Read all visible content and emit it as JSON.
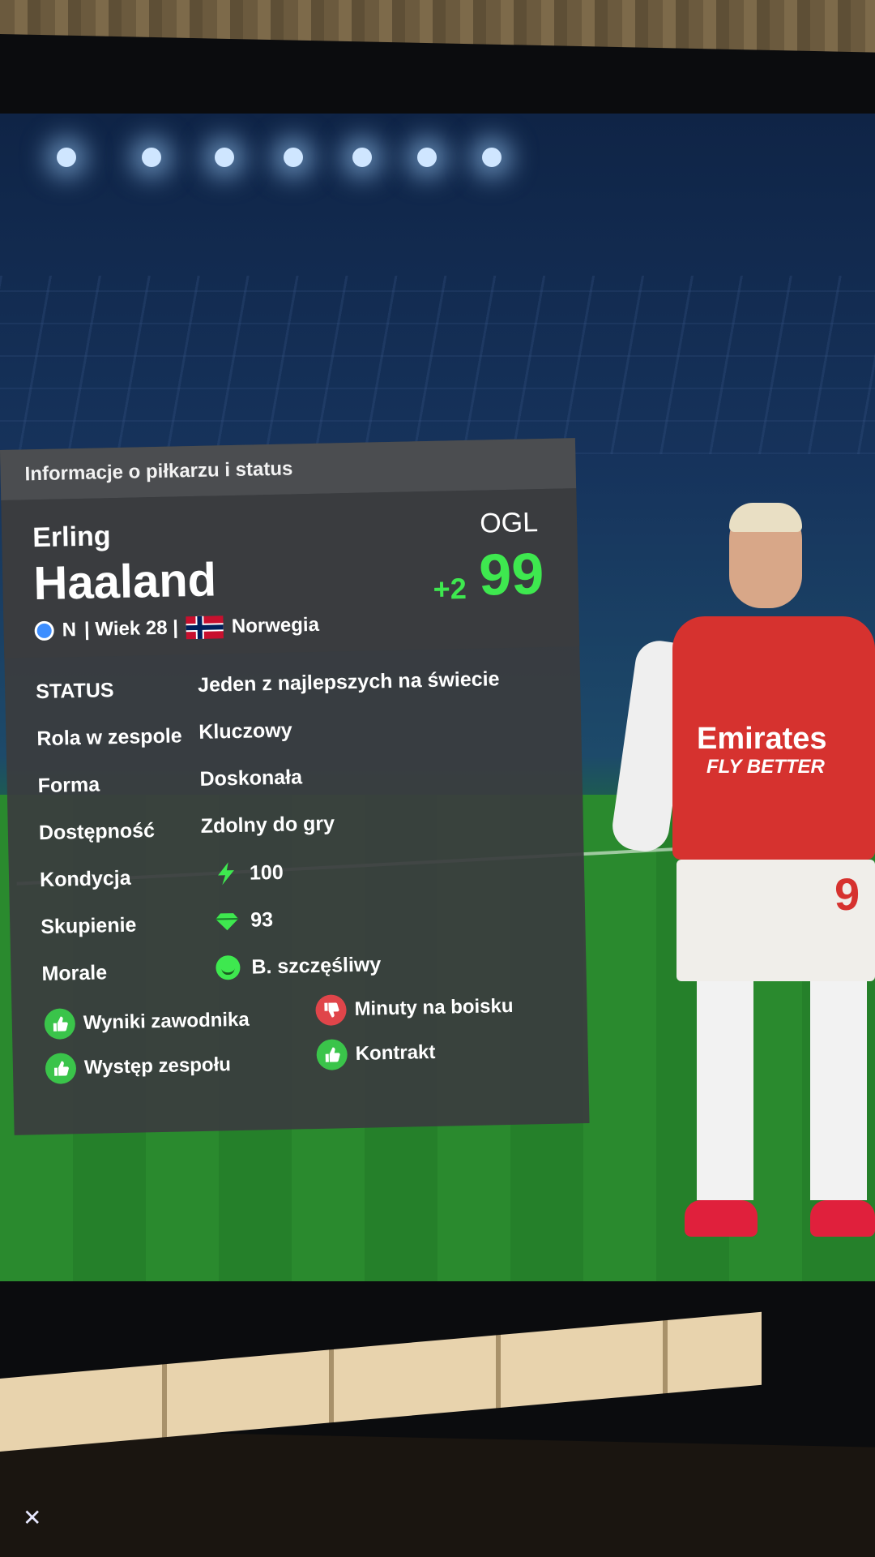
{
  "panel": {
    "title": "Informacje o piłkarzu i status",
    "first_name": "Erling",
    "last_name": "Haaland",
    "ogl_label": "OGL",
    "ogl_delta": "+2",
    "ogl_value": "99",
    "position": "N",
    "age": "| Wiek 28 |",
    "nation": "Norwegia"
  },
  "rows": [
    {
      "label": "STATUS",
      "value": "Jeden z najlepszych na świecie"
    },
    {
      "label": "Rola w zespole",
      "value": "Kluczowy"
    },
    {
      "label": "Forma",
      "value": "Doskonała"
    },
    {
      "label": "Dostępność",
      "value": "Zdolny do gry"
    },
    {
      "label": "Kondycja",
      "value": "100",
      "icon": "lightning-icon"
    },
    {
      "label": "Skupienie",
      "value": "93",
      "icon": "gem-icon"
    },
    {
      "label": "Morale",
      "value": "B. szczęśliwy",
      "icon": "smiley-icon"
    }
  ],
  "factors": [
    {
      "label": "Wyniki zawodnika",
      "state": "positive"
    },
    {
      "label": "Minuty na boisku",
      "state": "negative"
    },
    {
      "label": "Występ zespołu",
      "state": "positive"
    },
    {
      "label": "Kontrakt",
      "state": "positive"
    }
  ],
  "jersey": {
    "sponsor": "Emirates",
    "slogan": "FLY BETTER",
    "number": "9"
  },
  "colors": {
    "accent_green": "#3ee84f",
    "negative_red": "#e0454a",
    "panel_bg": "#3a3c3f"
  }
}
